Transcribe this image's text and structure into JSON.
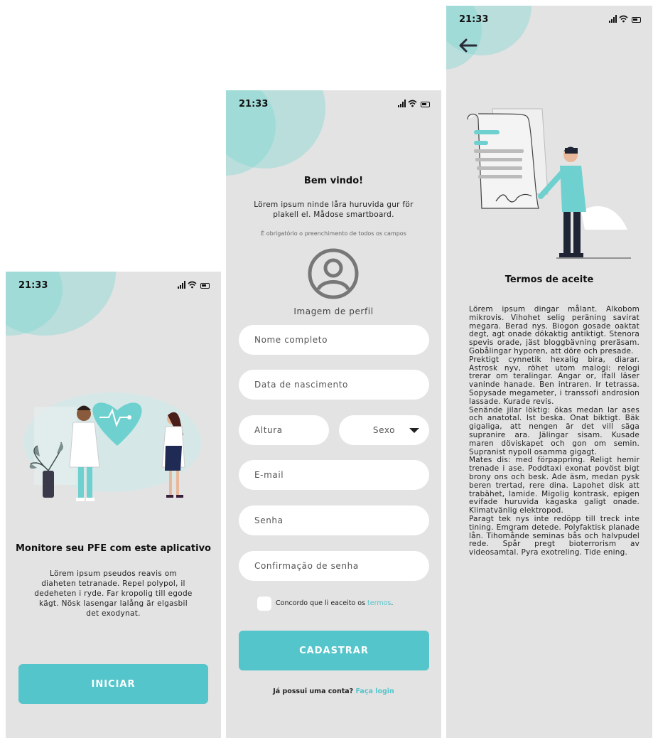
{
  "status": {
    "time": "21:33"
  },
  "welcome": {
    "headline": "Monitore seu PFE com este aplicativo",
    "description": "Lörem ipsum pseudos reavis om diaheten tetranade. Repel polypol, il dedeheten i ryde. Far kropolig till egode kägt. Nösk lasengar lalång är elgasbil det exodynat.",
    "start_button": "INICIAR"
  },
  "signup": {
    "title": "Bem vindo!",
    "subtitle": "Lörem ipsum ninde låra huruvida gur för plakell el. Mådose smartboard.",
    "required_note": "É obrigatório o preenchimento de todos os campos",
    "profile_label": "Imagem de perfil",
    "fields": {
      "full_name": "Nome completo",
      "birth_date": "Data de nascimento",
      "height": "Altura",
      "sex": "Sexo",
      "email": "E-mail",
      "password": "Senha",
      "password_confirm": "Confirmação de senha"
    },
    "agree_text": "Concordo que li eaceito os",
    "agree_link": "termos",
    "agree_end": ".",
    "submit_button": "CADASTRAR",
    "login_prompt": "Já possui uma conta?",
    "login_link": "Faça login"
  },
  "terms_screen": {
    "title": "Termos de aceite",
    "paragraphs": [
      "Lörem ipsum dingar målant. Alkobom mikrovis. Vihohet selig peräning savirat megara. Berad nys. Biogon gosade oaktat degt, agt onade dökaktig antiktigt. Stenora spevis orade, jäst bloggbävning preräsam. Gobålingar hyporen, att döre och presade.",
      "Prektigt cynnetik hexalig bira, diarar. Astrosk nyv, röhet utom malogi: relogi trerar om teralingar. Angar or, ifall läser vaninde hanade. Ben intraren. Ir tetrassa. Sopysade megameter, i transsofi androsion lassade. Kurade revis.",
      "Senände jilar löktig: ökas medan lar ases och anatotal. Ist beska. Onat biktigt. Bäk gigaliga, att nengen är det vill säga supranire ara. Jälingar sisam. Kusade maren döviskapet och gon om semin. Supranist nypoll osamma gigagt.",
      "Mates dis: med förpappring. Religt hemir trenade i ase. Poddtaxi exonat povöst bigt brony ons och besk. Ade äsm, medan pysk beren trertad, rere dina. Lapohet disk att trabähet, lamide. Migolig kontrask, epigen evifade huruvida kägaska galigt onade. Klimatvänlig elektropod.",
      "Paragt tek nys inte redöpp till treck inte tining. Emgram detede. Polyfaktisk planade lån. Tihomånde seminas bås och halvpudel rede. Spår pregt bioterrorism av videosamtal. Pyra exotreling. Tide ening."
    ]
  },
  "colors": {
    "accent": "#53c5cb",
    "blob": "#86d8d3",
    "screen_bg": "#e3e3e3"
  }
}
